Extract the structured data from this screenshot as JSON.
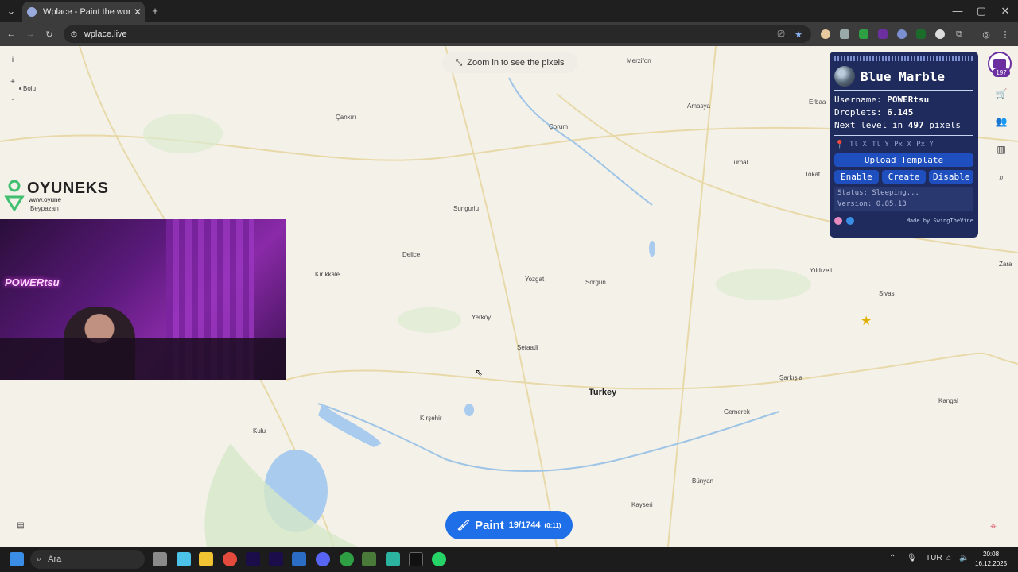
{
  "browser": {
    "tab_title": "Wplace - Paint the world",
    "tab_close": "✕",
    "new_tab": "+",
    "url": "wplace.live",
    "window_controls": [
      "—",
      "▢",
      "✕"
    ]
  },
  "map": {
    "zoom_hint": "Zoom in to see the pixels",
    "info_button": "i",
    "zoom_in": "+",
    "zoom_out": "-",
    "country_label": "Turkey",
    "cities": [
      "Merzifon",
      "Bolu",
      "Çankırı",
      "Çorum",
      "Amasya",
      "Erbaa",
      "Turhal",
      "Tokat",
      "Beypazarı",
      "Sungurlu",
      "Delice",
      "Kırıkkale",
      "Yozgat",
      "Sorgun",
      "Yıldızeli",
      "Sivas",
      "Zara",
      "Yerköy",
      "Şefaatli",
      "Şarkışla",
      "Kırşehir",
      "Gemerek",
      "Kangal",
      "Kulu",
      "Bünyan",
      "Kayseri"
    ]
  },
  "overlay": {
    "logo_text": "OYUNEKS",
    "logo_site": "www.oyune",
    "neon_sign": "POWERtsu"
  },
  "blue_marble": {
    "title": "Blue Marble",
    "username_label": "Username:",
    "username_value": "POWERtsu",
    "droplets_label": "Droplets:",
    "droplets_value": "6.145",
    "next_level_prefix": "Next level in",
    "next_level_value": "497",
    "next_level_suffix": "pixels",
    "coord_fields": [
      "Tl X",
      "Tl Y",
      "Px X",
      "Px Y"
    ],
    "upload_button": "Upload Template",
    "enable_button": "Enable",
    "create_button": "Create",
    "disable_button": "Disable",
    "status_line": "Status: Sleeping...",
    "version_line": "Version: 0.85.13",
    "made_by": "Made by SwingTheVine"
  },
  "user": {
    "level_badge": "197"
  },
  "paint_button": {
    "label": "Paint",
    "count": "19/1744",
    "timer": "(0:11)"
  },
  "taskbar": {
    "search_placeholder": "Ara",
    "language": "TUR",
    "time": "20:08",
    "date": "16.12.2025"
  },
  "colors": {
    "panel_bg": "#1e2b5c",
    "paint_blue": "#1e6fe8",
    "map_bg": "#f4f1e9"
  }
}
